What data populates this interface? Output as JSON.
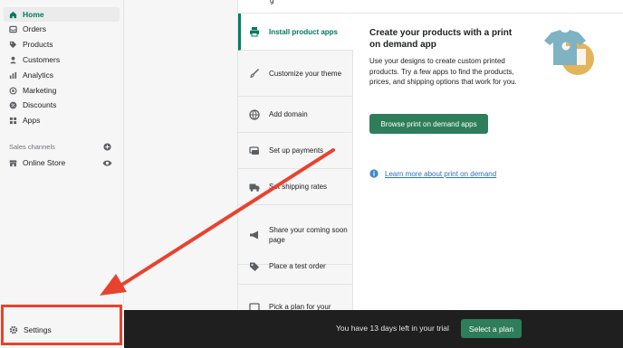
{
  "sidebar": {
    "items": [
      {
        "label": "Home",
        "icon": "home-icon",
        "active": true
      },
      {
        "label": "Orders",
        "icon": "orders-icon",
        "active": false
      },
      {
        "label": "Products",
        "icon": "tag-icon",
        "active": false
      },
      {
        "label": "Customers",
        "icon": "person-icon",
        "active": false
      },
      {
        "label": "Analytics",
        "icon": "bar-chart-icon",
        "active": false
      },
      {
        "label": "Marketing",
        "icon": "target-icon",
        "active": false
      },
      {
        "label": "Discounts",
        "icon": "discount-icon",
        "active": false
      },
      {
        "label": "Apps",
        "icon": "apps-icon",
        "active": false
      }
    ],
    "sales_channels_label": "Sales channels",
    "online_store_label": "Online Store",
    "settings_label": "Settings"
  },
  "top_fragment": "g",
  "steps": [
    {
      "label": "Install product apps",
      "icon": "printer-icon",
      "active": true
    },
    {
      "label": "Customize your theme",
      "icon": "brush-icon",
      "active": false
    },
    {
      "label": "Add domain",
      "icon": "globe-icon",
      "active": false
    },
    {
      "label": "Set up payments",
      "icon": "payment-card-icon",
      "active": false
    },
    {
      "label": "Set shipping rates",
      "icon": "truck-icon",
      "active": false
    },
    {
      "label": "Share your coming soon page",
      "icon": "megaphone-icon",
      "active": false
    },
    {
      "label": "Place a test order",
      "icon": "tag-icon",
      "active": false
    },
    {
      "label": "Pick a plan for your",
      "icon": "plan-icon",
      "active": false
    }
  ],
  "detail": {
    "title": "Create your products with a print on demand app",
    "body": "Use your designs to create custom printed products. Try a few apps to find the products, prices, and shipping options that work for you.",
    "button_label": "Browse print on demand apps",
    "link_label": "Learn more about print on demand"
  },
  "trial_bar": {
    "text": "You have 13 days left in your trial",
    "button_label": "Select a plan"
  },
  "colors": {
    "accent_green": "#008060",
    "button_green": "#2e7d5b",
    "annotation_red": "#e8422e",
    "link_blue": "#2c6ecb"
  }
}
